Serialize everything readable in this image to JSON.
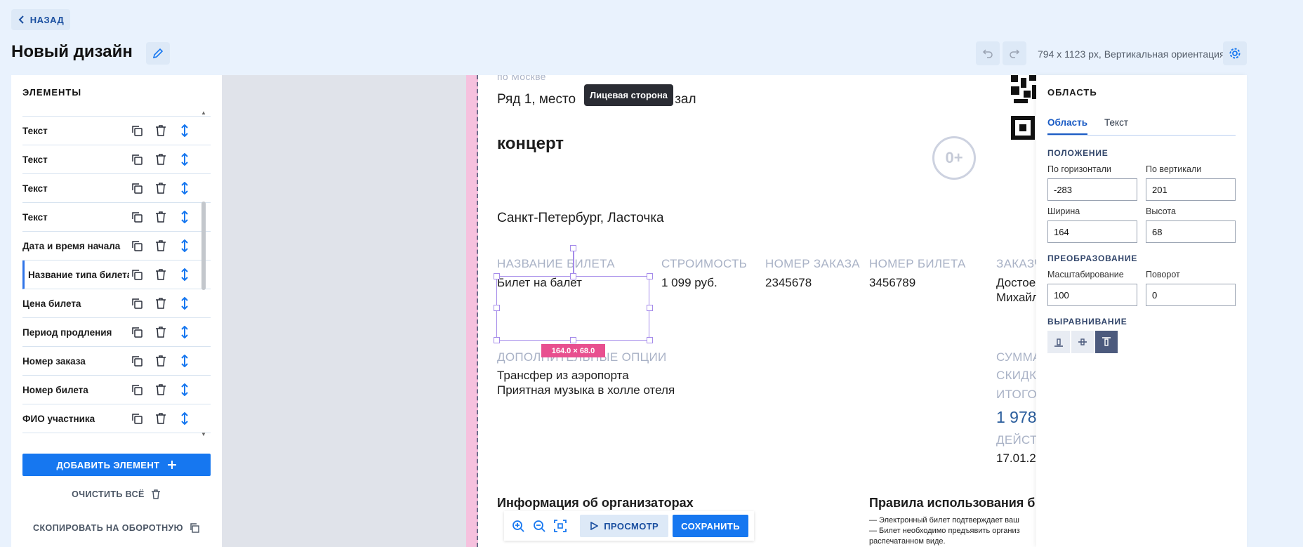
{
  "header": {
    "back_label": "НАЗАД",
    "title": "Новый дизайн",
    "page_info": "794 x 1123 px, Вертикальная ориентация"
  },
  "elements_panel": {
    "heading": "ЭЛЕМЕНТЫ",
    "items": [
      {
        "label": "Текст"
      },
      {
        "label": "Текст"
      },
      {
        "label": "Текст"
      },
      {
        "label": "Текст"
      },
      {
        "label": "Дата и время начала"
      },
      {
        "label": "Название типа билета"
      },
      {
        "label": "Цена билета"
      },
      {
        "label": "Период продления"
      },
      {
        "label": "Номер заказа"
      },
      {
        "label": "Номер билета"
      },
      {
        "label": "ФИО участника"
      }
    ],
    "active_index": 5,
    "add_label": "ДОБАВИТЬ ЭЛЕМЕНТ",
    "clear_label": "ОЧИСТИТЬ ВСЁ",
    "copy_back_label": "СКОПИРОВАТЬ НА ОБОРОТНУЮ"
  },
  "ticket": {
    "top_cut": "по Москве",
    "row_seat_a": "Ряд 1, место",
    "row_seat_b": "алый зал",
    "event": "концерт",
    "age": "0+",
    "venue": "Санкт-Петербург, Ласточка",
    "col_ticket_name": "НАЗВАНИЕ БИЛЕТА",
    "col_price": "СТРОИМОСТЬ",
    "col_order": "НОМЕР ЗАКАЗА",
    "col_ticket_no": "НОМЕР БИЛЕТА",
    "col_customer": "ЗАКАЗЧ",
    "val_ticket_name": "Билет на балет",
    "val_price": "1 099 руб.",
    "val_order": "2345678",
    "val_ticket_no": "3456789",
    "val_customer_1": "Достое",
    "val_customer_2": "Михайл",
    "options_title": "ДОПОЛНИТЕЛЬНЫЕ ОПЦИИ",
    "option_1": "Трансфер из аэропорта",
    "option_2": "Приятная музыка в холле отеля",
    "sum_label": "СУММА",
    "discount_label": "СКИДК",
    "total_label": "ИТОГО",
    "total_value": "1 978",
    "valid_label": "ДЕЙСТ",
    "valid_value": "17.01.2",
    "organizers_title": "Информация об организаторах",
    "rules_title": "Правила использования б",
    "rule_1": "— Электронный билет подтверждает ваш",
    "rule_2": "— Билет необходимо предъявить организ",
    "rule_3": "распечатанном виде."
  },
  "selection": {
    "size_label": "164.0 × 68.0",
    "tooltip": "Лицевая сторона"
  },
  "bottom_bar": {
    "preview_label": "ПРОСМОТР",
    "save_label": "СОХРАНИТЬ"
  },
  "area_panel": {
    "heading": "ОБЛАСТЬ",
    "tabs": [
      "Область",
      "Текст"
    ],
    "position_title": "ПОЛОЖЕНИЕ",
    "horizontal_label": "По горизонтали",
    "horizontal_value": "-283",
    "vertical_label": "По вертикали",
    "vertical_value": "201",
    "width_label": "Ширина",
    "width_value": "164",
    "height_label": "Высота",
    "height_value": "68",
    "transform_title": "ПРЕОБРАЗОВАНИЕ",
    "scale_label": "Масштабирование",
    "scale_value": "100",
    "rotate_label": "Поворот",
    "rotate_value": "0",
    "align_title": "ВЫРАВНИВАНИЕ"
  },
  "colors": {
    "accent": "#1677f0",
    "page_bg": "#e9f2fd",
    "selection": "#a58bea",
    "size_badge": "#e84f8f"
  },
  "icons": [
    "chevron-left-icon",
    "pencil-icon",
    "undo-icon",
    "redo-icon",
    "gear-icon",
    "copy-icon",
    "trash-icon",
    "move-vertical-icon",
    "plus-icon",
    "zoom-in-icon",
    "zoom-out-icon",
    "fit-screen-icon",
    "play-icon"
  ]
}
